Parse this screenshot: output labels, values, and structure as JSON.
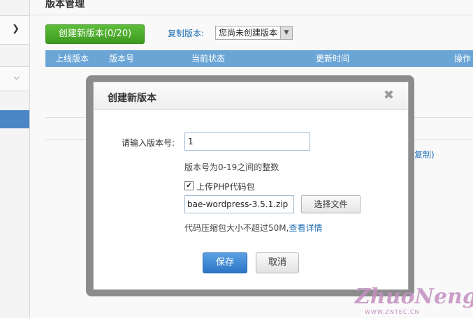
{
  "page": {
    "title": "版本管理",
    "create_button": "创建新版本(0/20)",
    "copy_label": "复制版本:",
    "copy_select_value": "您尚未创建版本",
    "table_headers": [
      "上线版本",
      "版本号",
      "当前状态",
      "更新时间",
      "操作"
    ],
    "partial_link": "比复制)"
  },
  "dialog": {
    "title": "创建新版本",
    "version_label": "请输入版本号:",
    "version_value": "1",
    "version_hint": "版本号为0-19之间的整数",
    "upload_checkbox_label": "上传PHP代码包",
    "upload_checked": true,
    "file_value": "bae-wordpress-3.5.1.zip",
    "choose_file_button": "选择文件",
    "size_hint": "代码压缩包大小不超过50M,",
    "details_link": "查看详情",
    "save_button": "保存",
    "cancel_button": "取消"
  },
  "watermark": {
    "text": "ZhuoNeng's",
    "url": "WWW.ZNTEC.CN"
  },
  "colors": {
    "accent_blue": "#2d75c5",
    "header_blue": "#6aa5d6",
    "green": "#4aa92a"
  }
}
